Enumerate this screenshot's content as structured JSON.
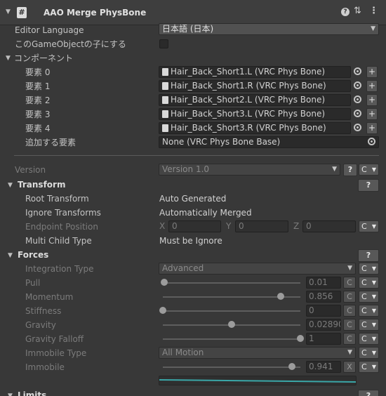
{
  "header": {
    "title": "AAO Merge PhysBone",
    "script_glyph": "#"
  },
  "editor_language": {
    "label": "Editor Language",
    "value": "日本語 (日本)"
  },
  "child_option": {
    "label": "このGameObjectの子にする",
    "checked": false
  },
  "components": {
    "label": "コンポーネント",
    "items": [
      {
        "label": "要素 0",
        "value": "Hair_Back_Short1.L (VRC Phys Bone)"
      },
      {
        "label": "要素 1",
        "value": "Hair_Back_Short1.R (VRC Phys Bone)"
      },
      {
        "label": "要素 2",
        "value": "Hair_Back_Short2.L (VRC Phys Bone)"
      },
      {
        "label": "要素 3",
        "value": "Hair_Back_Short3.L (VRC Phys Bone)"
      },
      {
        "label": "要素 4",
        "value": "Hair_Back_Short3.R (VRC Phys Bone)"
      }
    ],
    "add_label": "追加する要素",
    "add_value": "None (VRC Phys Bone Base)",
    "plus": "+"
  },
  "version": {
    "label": "Version",
    "value": "Version 1.0",
    "help": "?",
    "c": "C"
  },
  "transform": {
    "title": "Transform",
    "help": "?",
    "root_label": "Root Transform",
    "root_value": "Auto Generated",
    "ignore_label": "Ignore Transforms",
    "ignore_value": "Automatically Merged",
    "endpoint_label": "Endpoint Position",
    "x_label": "X",
    "x_value": "0",
    "y_label": "Y",
    "y_value": "0",
    "z_label": "Z",
    "z_value": "0",
    "multi_label": "Multi Child Type",
    "multi_value": "Must be Ignore",
    "c": "C"
  },
  "forces": {
    "title": "Forces",
    "help": "?",
    "integration_label": "Integration Type",
    "integration_value": "Advanced",
    "c": "C",
    "sliders": [
      {
        "label": "Pull",
        "value": "0.01",
        "level": 0.01,
        "btn": "C"
      },
      {
        "label": "Momentum",
        "value": "0.856",
        "level": 0.856,
        "btn": "C"
      },
      {
        "label": "Stiffness",
        "value": "0",
        "level": 0,
        "btn": "C"
      },
      {
        "label": "Gravity",
        "value": "0.02890",
        "level": 0.5,
        "btn": "C"
      },
      {
        "label": "Gravity Falloff",
        "value": "1",
        "level": 1,
        "btn": "C"
      }
    ],
    "immobile_type_label": "Immobile Type",
    "immobile_type_value": "All Motion",
    "immobile_label": "Immobile",
    "immobile_value": "0.941",
    "immobile_level": 0.941,
    "immobile_btn": "X"
  },
  "limits": {
    "title": "Limits",
    "help": "?"
  },
  "colors": {
    "bg": "#383838",
    "field": "#2a2a2a",
    "curve": "#3aa7a8"
  }
}
